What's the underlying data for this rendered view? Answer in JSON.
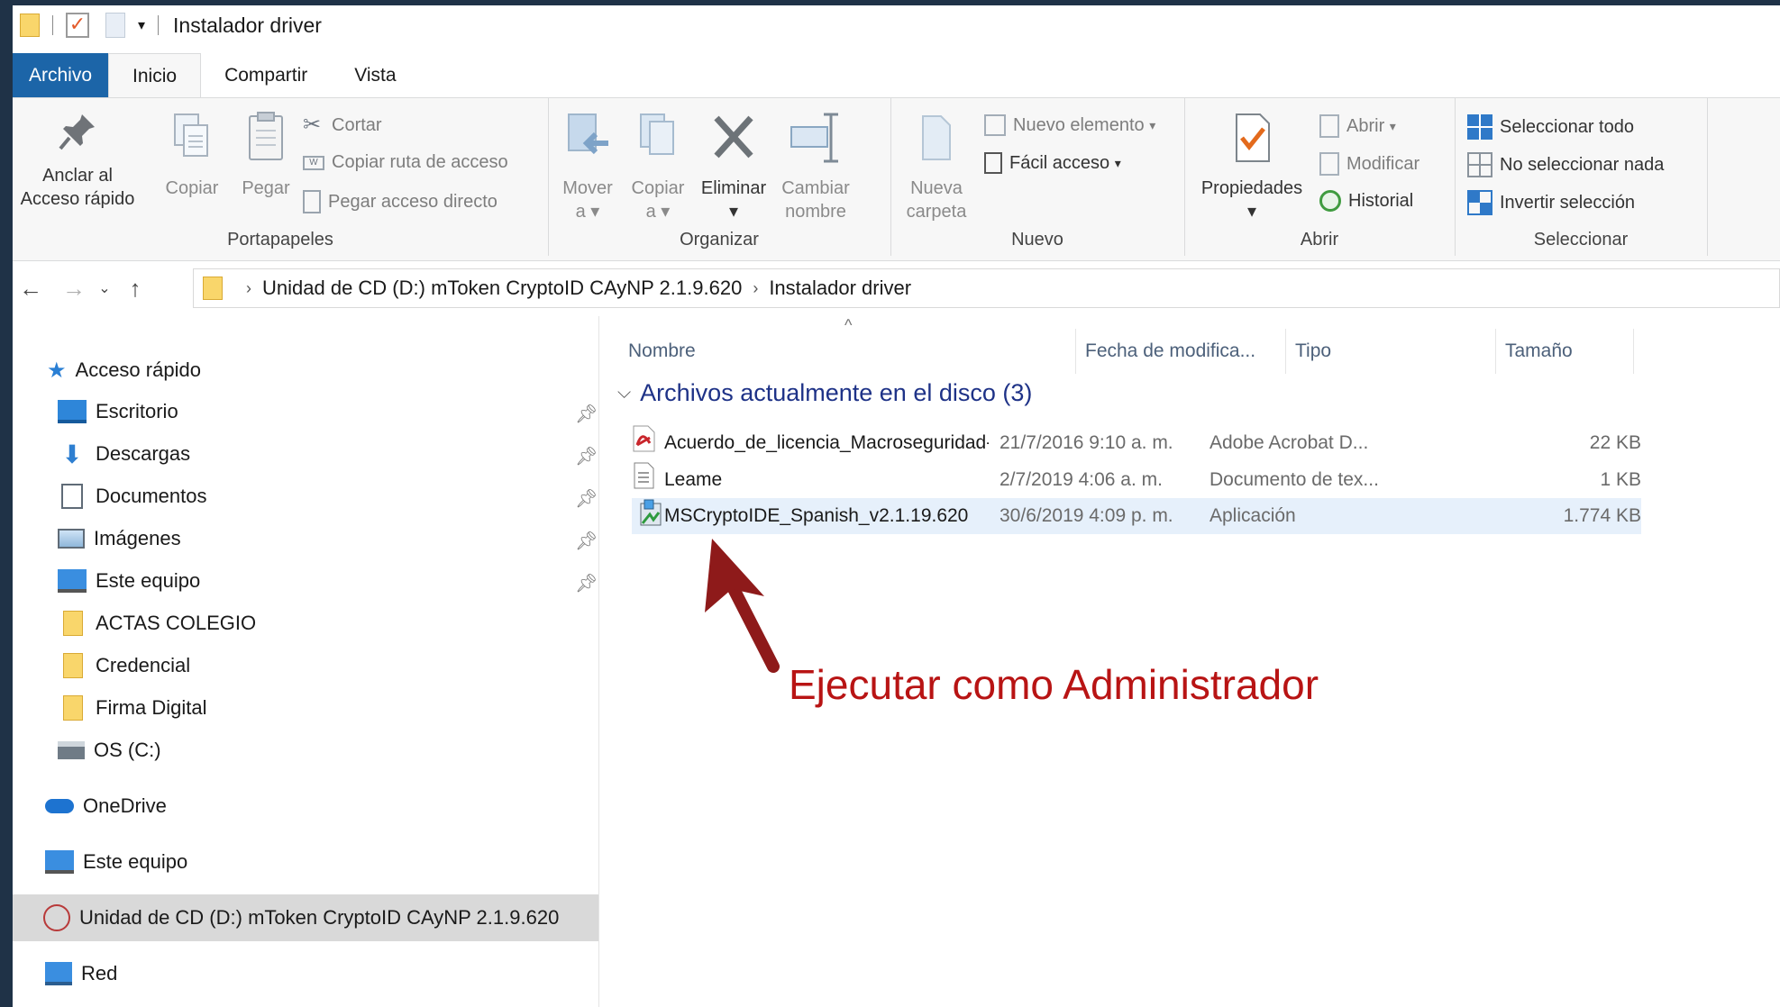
{
  "window": {
    "title": "Instalador driver"
  },
  "tabs": [
    {
      "label": "Archivo"
    },
    {
      "label": "Inicio"
    },
    {
      "label": "Compartir"
    },
    {
      "label": "Vista"
    }
  ],
  "ribbon": {
    "portapapeles": {
      "label": "Portapapeles",
      "pin_line1": "Anclar al",
      "pin_line2": "Acceso rápido",
      "copy": "Copiar",
      "paste": "Pegar",
      "cut": "Cortar",
      "copy_path": "Copiar ruta de acceso",
      "paste_shortcut": "Pegar acceso directo"
    },
    "organizar": {
      "label": "Organizar",
      "move_l1": "Mover",
      "move_l2": "a",
      "copy_l1": "Copiar",
      "copy_l2": "a",
      "delete": "Eliminar",
      "rename_l1": "Cambiar",
      "rename_l2": "nombre"
    },
    "nuevo": {
      "label": "Nuevo",
      "folder_l1": "Nueva",
      "folder_l2": "carpeta",
      "new_item": "Nuevo elemento",
      "easy_access": "Fácil acceso"
    },
    "abrir": {
      "label": "Abrir",
      "properties": "Propiedades",
      "open": "Abrir",
      "edit": "Modificar",
      "history": "Historial"
    },
    "seleccionar": {
      "label": "Seleccionar",
      "all": "Seleccionar todo",
      "none": "No seleccionar nada",
      "invert": "Invertir selección"
    }
  },
  "address": {
    "crumbs": [
      "Unidad de CD (D:) mToken CryptoID CAyNP 2.1.9.620",
      "Instalador driver"
    ]
  },
  "nav": {
    "quick_access": "Acceso rápido",
    "pinned": [
      {
        "label": "Escritorio"
      },
      {
        "label": "Descargas"
      },
      {
        "label": "Documentos"
      },
      {
        "label": "Imágenes"
      },
      {
        "label": "Este equipo"
      }
    ],
    "folders": [
      {
        "label": "ACTAS COLEGIO"
      },
      {
        "label": "Credencial"
      },
      {
        "label": "Firma Digital"
      },
      {
        "label": "OS (C:)"
      }
    ],
    "onedrive": "OneDrive",
    "this_pc": "Este equipo",
    "cd_drive": "Unidad de CD (D:) mToken CryptoID CAyNP 2.1.9.620",
    "network": "Red"
  },
  "columns": {
    "name": "Nombre",
    "date": "Fecha de modifica...",
    "type": "Tipo",
    "size": "Tamaño"
  },
  "group_header": "Archivos actualmente en el disco (3)",
  "files": [
    {
      "name": "Acuerdo_de_licencia_Macroseguridad-(...",
      "date": "21/7/2016 9:10 a. m.",
      "type": "Adobe Acrobat D...",
      "size": "22 KB"
    },
    {
      "name": "Leame",
      "date": "2/7/2019 4:06 a. m.",
      "type": "Documento de tex...",
      "size": "1 KB"
    },
    {
      "name": "MSCryptoIDE_Spanish_v2.1.19.620",
      "date": "30/6/2019 4:09 p. m.",
      "type": "Aplicación",
      "size": "1.774 KB"
    }
  ],
  "annotation": "Ejecutar como Administrador",
  "colors": {
    "accent": "#1c65a8",
    "annotation": "#b81414",
    "selection": "#e6f0fb"
  }
}
